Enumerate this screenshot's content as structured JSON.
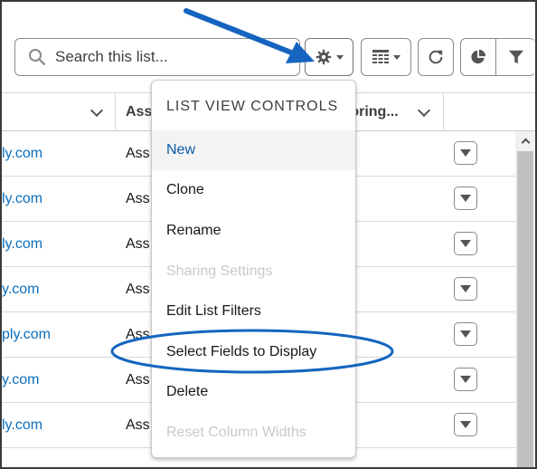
{
  "search": {
    "placeholder": "Search this list..."
  },
  "toolbar": {
    "icons": [
      "gear-icon",
      "table-icon",
      "refresh-icon",
      "pie-chart-icon",
      "filter-icon"
    ]
  },
  "table": {
    "headers": [
      "Ass",
      "toring..."
    ],
    "rows": [
      {
        "email": "ly.com",
        "assigned": "Ass"
      },
      {
        "email": "ly.com",
        "assigned": "Ass"
      },
      {
        "email": "ly.com",
        "assigned": "Ass"
      },
      {
        "email": "y.com",
        "assigned": "Ass"
      },
      {
        "email": "ply.com",
        "assigned": "Ass"
      },
      {
        "email": "y.com",
        "assigned": "Ass"
      },
      {
        "email": "ly.com",
        "assigned": "Ass"
      }
    ]
  },
  "menu": {
    "title": "LIST VIEW CONTROLS",
    "items": [
      {
        "label": "New",
        "state": "active"
      },
      {
        "label": "Clone",
        "state": "enabled"
      },
      {
        "label": "Rename",
        "state": "enabled"
      },
      {
        "label": "Sharing Settings",
        "state": "disabled"
      },
      {
        "label": "Edit List Filters",
        "state": "enabled"
      },
      {
        "label": "Select Fields to Display",
        "state": "enabled"
      },
      {
        "label": "Delete",
        "state": "enabled"
      },
      {
        "label": "Reset Column Widths",
        "state": "disabled"
      }
    ]
  },
  "colors": {
    "link": "#0b6ebd",
    "menu_active_text": "#0b5cab",
    "annotation_blue": "#1565c0",
    "disabled_text": "#c9c9c9"
  }
}
